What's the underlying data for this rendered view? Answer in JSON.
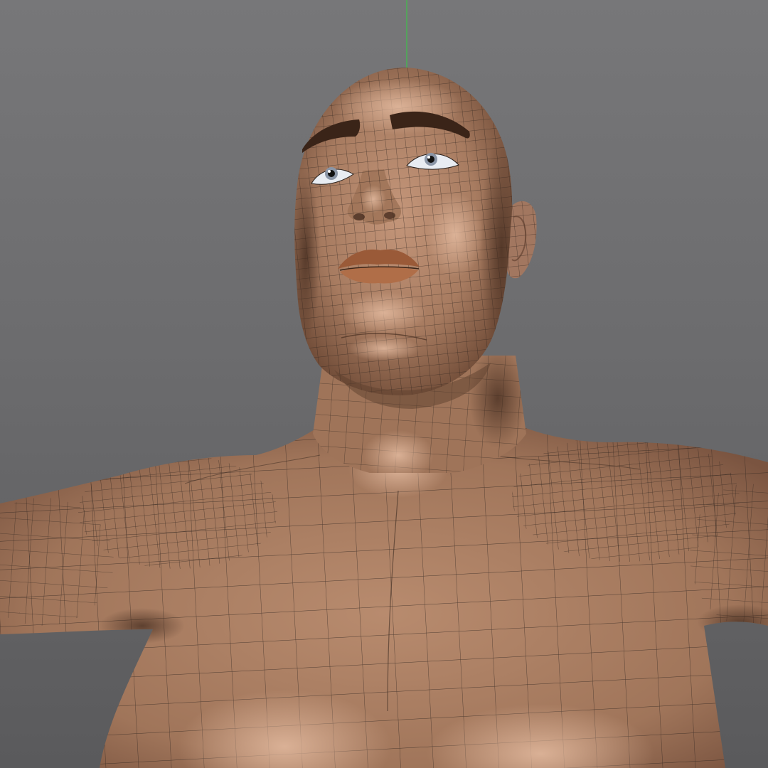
{
  "viewport": {
    "background_top": "#777779",
    "background_bottom": "#5a5a5c",
    "axis_color": "#3fbf4a",
    "skin_color": "#a87d62",
    "skin_highlight": "#d9ad90",
    "skin_shadow": "#6e4a36",
    "wire_color": "#2a211c",
    "brow_color": "#3a2418",
    "lip_color": "#9a5a38",
    "eye_color": "#e8ecf2"
  },
  "model": {
    "shading_mode": "smooth-shaded-with-wireframe",
    "subject": "human-bust"
  }
}
